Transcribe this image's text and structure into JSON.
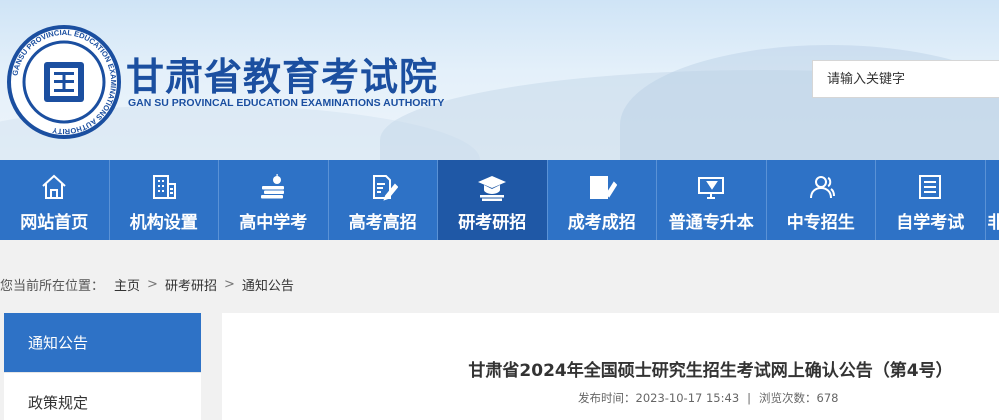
{
  "header": {
    "title": "甘肃省教育考试院",
    "subtitle": "GAN SU PROVINCAL EDUCATION EXAMINATIONS AUTHORITY",
    "logo_ring_text": "GANSU PROVINCIAL EDUCATION EXAMINATIONS AUTHORITY",
    "logo_top_text": "甘肃省教育考试院",
    "search_placeholder": "请输入关键字"
  },
  "nav": {
    "items": [
      {
        "label": "网站首页",
        "icon": "home-icon"
      },
      {
        "label": "机构设置",
        "icon": "building-icon"
      },
      {
        "label": "高中学考",
        "icon": "books-apple-icon"
      },
      {
        "label": "高考高招",
        "icon": "pen-paper-icon"
      },
      {
        "label": "研考研招",
        "icon": "graduation-cap-icon"
      },
      {
        "label": "成考成招",
        "icon": "book-pen-icon"
      },
      {
        "label": "普通专升本",
        "icon": "computer-icon"
      },
      {
        "label": "中专招生",
        "icon": "users-icon"
      },
      {
        "label": "自学考试",
        "icon": "document-list-icon"
      },
      {
        "label": "非",
        "icon": ""
      }
    ],
    "active_index": 4
  },
  "breadcrumb": {
    "prefix": "您当前所在位置：",
    "items": [
      "主页",
      "研考研招",
      "通知公告"
    ],
    "separator": ">"
  },
  "sidebar": {
    "items": [
      "通知公告",
      "政策规定"
    ],
    "active_index": 0
  },
  "article": {
    "title": "甘肃省2024年全国硕士研究生招生考试网上确认公告（第4号）",
    "publish_label": "发布时间：",
    "publish_time": "2023-10-17 15:43",
    "views_label": "浏览次数：",
    "views": "678"
  },
  "colors": {
    "brand_blue": "#2e72c6",
    "active_blue": "#1f58a6",
    "title_blue": "#1b4fa0"
  }
}
